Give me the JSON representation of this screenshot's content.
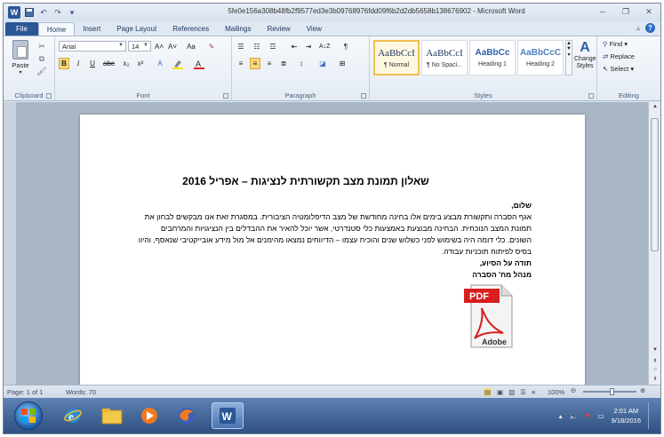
{
  "window": {
    "title": "5fe0e156a308b48fb2f9577ed3e3b09768976fdd09f6b2d2db5658b138676902 - Microsoft Word"
  },
  "tabs": [
    "File",
    "Home",
    "Insert",
    "Page Layout",
    "References",
    "Mailings",
    "Review",
    "View"
  ],
  "active_tab": "Home",
  "ribbon": {
    "clipboard": {
      "paste_label": "Paste",
      "group_label": "Clipboard"
    },
    "font": {
      "font_name": "Arial",
      "font_size": "14",
      "group_label": "Font",
      "bold": "B",
      "italic": "I",
      "underline": "U",
      "strike": "abc",
      "subscript": "x₂",
      "superscript": "x²",
      "grow": "A˄",
      "shrink": "A˅",
      "case": "Aa"
    },
    "paragraph": {
      "group_label": "Paragraph",
      "sort": "A↓Z",
      "pilcrow": "¶"
    },
    "styles": {
      "group_label": "Styles",
      "items": [
        {
          "sample": "AaBbCcI",
          "name": "¶ Normal"
        },
        {
          "sample": "AaBbCcI",
          "name": "¶ No Spaci..."
        },
        {
          "sample": "AaBbCc",
          "name": "Heading 1"
        },
        {
          "sample": "AaBbCcC",
          "name": "Heading 2"
        }
      ],
      "change_styles": "Change Styles"
    },
    "editing": {
      "group_label": "Editing",
      "find": "Find",
      "replace": "Replace",
      "select": "Select"
    }
  },
  "document": {
    "title": "שאלון תמונת מצב תקשורתית לנציגות – אפריל 2016",
    "greeting": "שלום,",
    "body": "אגף הסברה ותקשורת מבצע בימים אלו בחינה מחודשת של מצב הדיפלומטיה הציבורית. במסגרת זאת אנו מבקשים לבחון את תמונת המצב הנוכחית. הבחינה מבוצעת באמצעות כלי סטנדרטי, אשר יוכל להאיר את ההבדלים בין הנציגויות והמרחבים השונים. כלי דומה היה בשימוש לפני כשלוש שנים והוכיח עצמו – הדיווחים נמצאו מהימנים אל מול מידע אובייקטיבי שנאסף, והיוו בסיס לפיתוח תוכניות עבודה.",
    "thanks": "תודה על הסיוע,",
    "signature": "מנהל מח' הסברה",
    "pdf_label": "PDF",
    "adobe_label": "Adobe"
  },
  "statusbar": {
    "page": "Page: 1 of 1",
    "words": "Words: 70",
    "zoom": "100%"
  },
  "taskbar": {
    "time": "2:01 AM",
    "date": "9/18/2016"
  },
  "colors": {
    "accent": "#2b5797",
    "pdf_red": "#d81e1e"
  }
}
